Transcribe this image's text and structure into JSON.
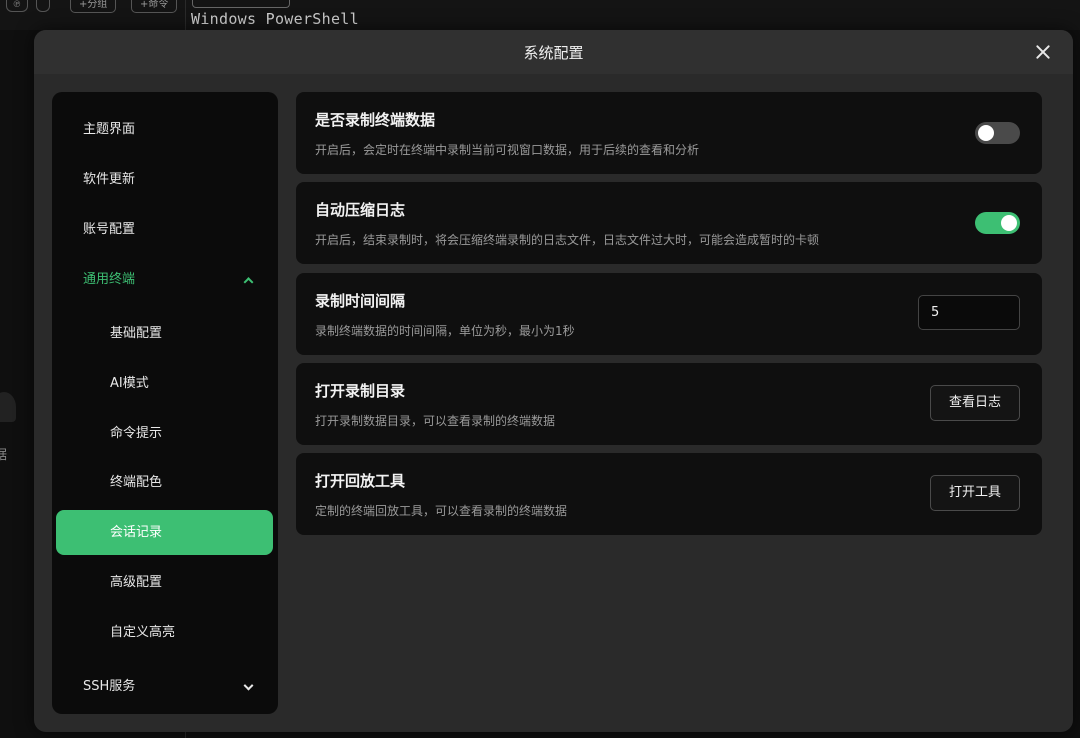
{
  "background": {
    "add_split_label": "+分组",
    "add_command_label": "+命令",
    "terminal_text": "Windows PowerShell",
    "left_partial_text": "据"
  },
  "dialog": {
    "title": "系统配置"
  },
  "sidebar": {
    "items": [
      {
        "label": "主题界面"
      },
      {
        "label": "软件更新"
      },
      {
        "label": "账号配置"
      },
      {
        "label": "通用终端"
      },
      {
        "label": "基础配置"
      },
      {
        "label": "AI模式"
      },
      {
        "label": "命令提示"
      },
      {
        "label": "终端配色"
      },
      {
        "label": "会话记录"
      },
      {
        "label": "高级配置"
      },
      {
        "label": "自定义高亮"
      },
      {
        "label": "SSH服务"
      }
    ]
  },
  "settings": [
    {
      "title": "是否录制终端数据",
      "desc": "开启后，会定时在终端中录制当前可视窗口数据，用于后续的查看和分析",
      "toggle": "off"
    },
    {
      "title": "自动压缩日志",
      "desc": "开启后，结束录制时，将会压缩终端录制的日志文件，日志文件过大时，可能会造成暂时的卡顿",
      "toggle": "on"
    },
    {
      "title": "录制时间间隔",
      "desc": "录制终端数据的时间间隔，单位为秒，最小为1秒",
      "value": "5"
    },
    {
      "title": "打开录制目录",
      "desc": "打开录制数据目录，可以查看录制的终端数据",
      "button": "查看日志"
    },
    {
      "title": "打开回放工具",
      "desc": "定制的终端回放工具，可以查看录制的终端数据",
      "button": "打开工具"
    }
  ],
  "colors": {
    "accent": "#3dbf73",
    "card_bg": "#0f0f0f",
    "dialog_bg": "#2a2a2a"
  }
}
